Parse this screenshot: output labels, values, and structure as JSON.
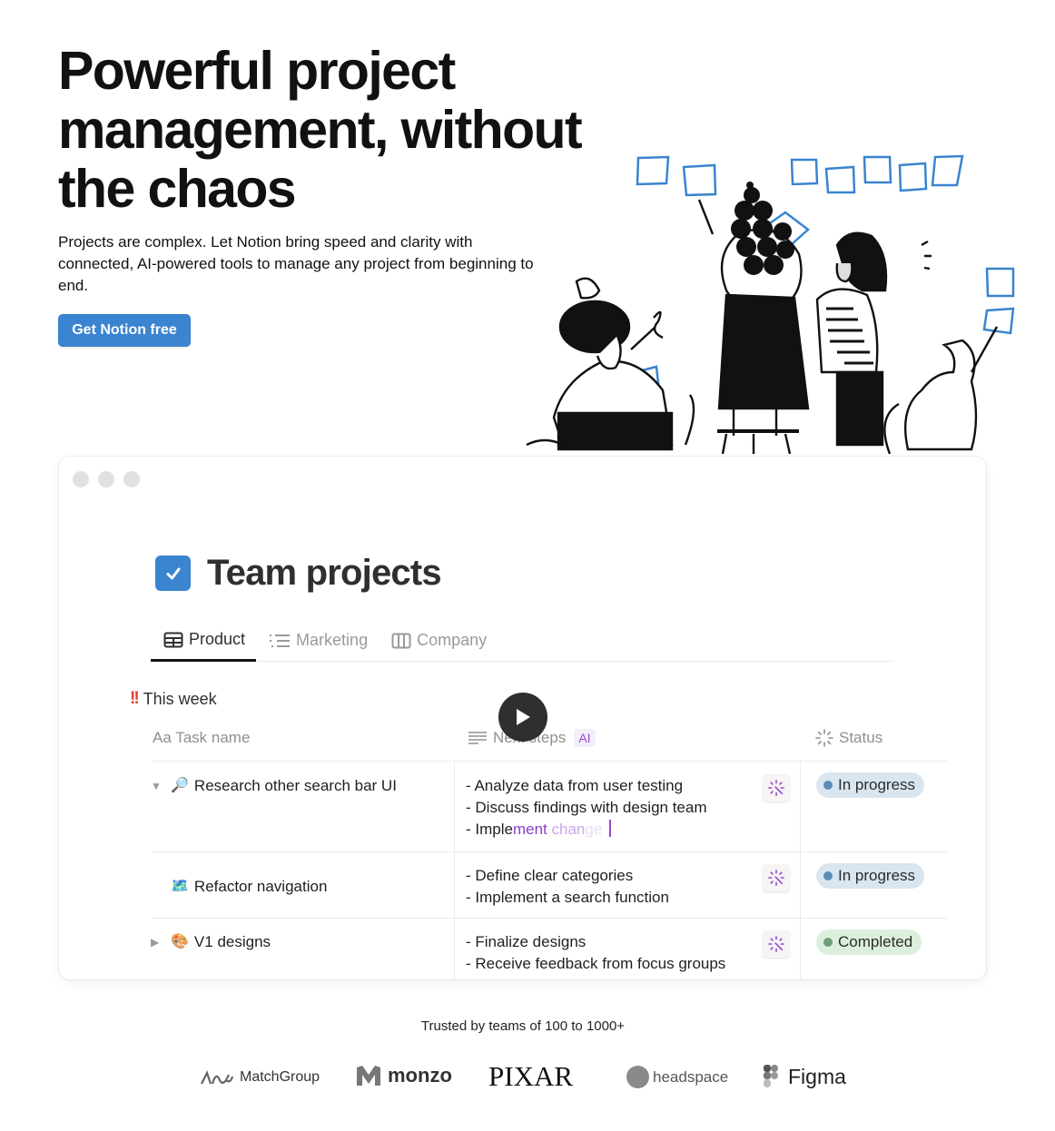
{
  "hero": {
    "title": "Powerful project management, without the chaos",
    "subtitle": "Projects are complex. Let Notion bring speed and clarity with connected, AI-powered tools to manage any project from beginning to end.",
    "cta_label": "Get Notion free"
  },
  "colors": {
    "brand_blue": "#3a84d0",
    "ai_purple": "#9a48d0",
    "in_progress_bg": "#d9e6f0",
    "in_progress_dot": "#5b8db8",
    "completed_bg": "#dcefdc",
    "completed_dot": "#6e9e7a"
  },
  "demo": {
    "page_title": "Team projects",
    "page_icon": "checkbox-icon",
    "tabs": [
      {
        "label": "Product",
        "icon": "table-icon",
        "active": true
      },
      {
        "label": "Marketing",
        "icon": "list-icon",
        "active": false
      },
      {
        "label": "Company",
        "icon": "board-icon",
        "active": false
      }
    ],
    "group": {
      "icon": "double-exclamation-icon",
      "label": "This week"
    },
    "columns": {
      "task": "Aa Task name",
      "next_steps": "Next steps",
      "ai_badge": "AI",
      "status": "Status"
    },
    "rows": [
      {
        "toggle": "▼",
        "emoji": "🔎",
        "task": "Research other search bar UI",
        "steps": [
          "- Analyze data from user testing",
          "- Discuss findings with design team"
        ],
        "typing": {
          "a": "- Imple",
          "b": "ment ",
          "c": "chan",
          "d": "ge"
        },
        "status": "In progress"
      },
      {
        "toggle": "",
        "emoji": "🗺️",
        "task": "Refactor navigation",
        "steps": [
          "- Define clear categories",
          "- Implement a search function"
        ],
        "status": "In progress"
      },
      {
        "toggle": "▶",
        "emoji": "🎨",
        "task": "V1 designs",
        "steps": [
          "- Finalize designs",
          "- Receive feedback from focus groups"
        ],
        "status": "Completed"
      }
    ]
  },
  "trust": {
    "label": "Trusted by teams of 100 to 1000+",
    "logos": [
      "MatchGroup",
      "monzo",
      "PIXAR",
      "headspace",
      "Figma"
    ]
  }
}
